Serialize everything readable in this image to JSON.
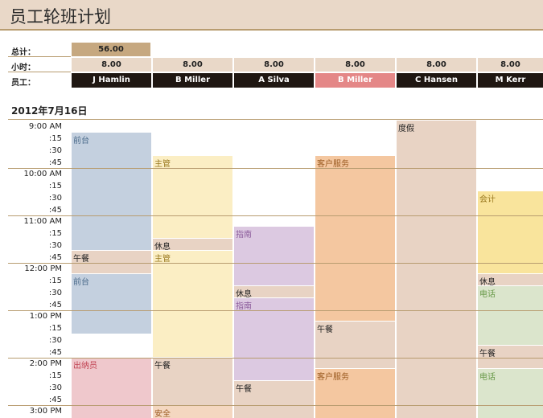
{
  "title": "员工轮班计划",
  "labels": {
    "total": "总计：",
    "hours": "小时：",
    "employee": "员工："
  },
  "total_value": "56.00",
  "date": "2012年7月16日",
  "employees": [
    {
      "name": "J Hamlin",
      "hours": "8.00"
    },
    {
      "name": "B Miller",
      "hours": "8.00"
    },
    {
      "name": "A Silva",
      "hours": "8.00"
    },
    {
      "name": "B Miller",
      "hours": "8.00"
    },
    {
      "name": "C Hansen",
      "hours": "8.00"
    },
    {
      "name": "M Kerr",
      "hours": "8.00"
    }
  ],
  "times": [
    "9:00 AM",
    ":15",
    ":30",
    ":45",
    "10:00 AM",
    ":15",
    ":30",
    ":45",
    "11:00 AM",
    ":15",
    ":30",
    ":45",
    "12:00 PM",
    ":15",
    ":30",
    ":45",
    "1:00 PM",
    ":15",
    ":30",
    ":45",
    "2:00 PM",
    ":15",
    ":30",
    ":45",
    "3:00 PM"
  ],
  "shifts": {
    "front_desk": "前台",
    "lunch": "午餐",
    "cashier": "出纳员",
    "supervisor": "主管",
    "break": "休息",
    "security": "安全",
    "guide": "指南",
    "customer_service": "客户服务",
    "vacation": "度假",
    "accounting": "会计",
    "phone": "电话"
  },
  "colors": {
    "header_bg": "#e9d8c8",
    "accent_line": "#b89c70",
    "total_bg": "#c6a880",
    "employee_bg": "#1f1712",
    "highlight_employee": "#e48787"
  }
}
